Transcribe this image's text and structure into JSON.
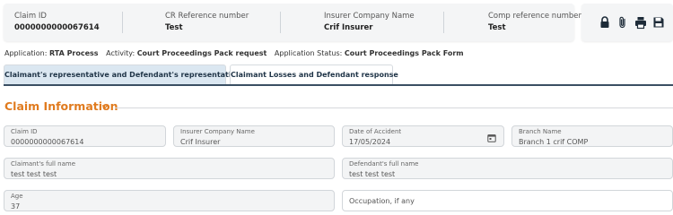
{
  "summary": {
    "claim_id_label": "Claim ID",
    "claim_id_value": "0000000000067614",
    "cr_ref_label": "CR Reference number",
    "cr_ref_value": "Test",
    "insurer_label": "Insurer Company Name",
    "insurer_value": "Crif Insurer",
    "comp_ref_label": "Comp reference number",
    "comp_ref_value": "Test"
  },
  "actions": [
    {
      "name": "lock-icon"
    },
    {
      "name": "paperclip-icon"
    },
    {
      "name": "print-icon"
    },
    {
      "name": "save-icon"
    }
  ],
  "status_bar": {
    "application_label": "Application:",
    "application_value": "RTA Process",
    "activity_label": "Activity:",
    "activity_value": "Court Proceedings Pack request",
    "app_status_label": "Application Status:",
    "app_status_value": "Court Proceedings Pack Form"
  },
  "tabs": {
    "tab1": "Claimant's representative and Defendant's representative",
    "tab2": "Claimant Losses and Defendant response"
  },
  "section": {
    "title": "Claim Information"
  },
  "fields": {
    "claim_id": {
      "label": "Claim ID",
      "value": "0000000000067614"
    },
    "insurer_name": {
      "label": "Insurer Company Name",
      "value": "Crif Insurer"
    },
    "date_of_accident": {
      "label": "Date of Accident",
      "value": "17/05/2024"
    },
    "branch_name": {
      "label": "Branch Name",
      "value": "Branch 1 crif COMP"
    },
    "claimant_full_name": {
      "label": "Claimant's full name",
      "value": "test test test"
    },
    "defendant_full_name": {
      "label": "Defendant's full name",
      "value": "test test test"
    },
    "age": {
      "label": "Age",
      "value": "37"
    },
    "occupation": {
      "placeholder": "Occupation, if any"
    }
  },
  "colors": {
    "accent_orange": "#e07b1f",
    "tab_active_bg": "#dbe7f1",
    "tab_underline": "#3b4f63",
    "field_bg": "#f3f4f5"
  }
}
